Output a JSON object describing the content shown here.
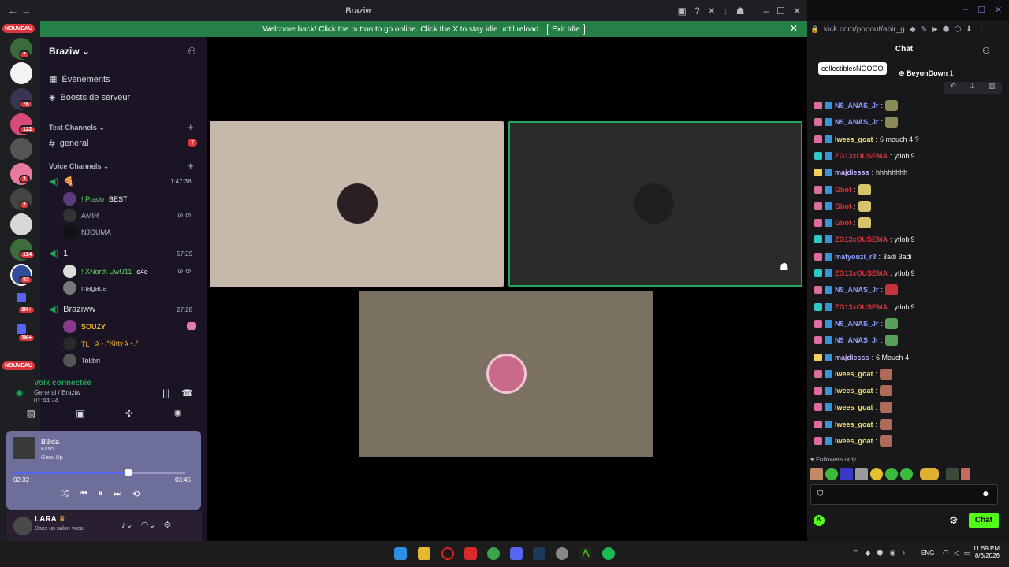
{
  "window": {
    "title": "Braziw"
  },
  "banner": {
    "text": "Welcome back! Click the button to go online. Click the X to stay idle until reload.",
    "button": "Exit Idle"
  },
  "guilds": {
    "new_top": "NOUVEAU",
    "new_bottom": "NOUVEAU",
    "badges": [
      "7",
      "76",
      "122",
      "3",
      "2",
      "114",
      "83",
      "1K+",
      "1K+"
    ]
  },
  "server": {
    "name": "Braziw",
    "events": "Événements",
    "boosts": "Boosts de serveur",
    "text_category": "Text Channels",
    "text_channels": [
      {
        "name": "general",
        "badge": "7"
      }
    ],
    "voice_category": "Voice Channels",
    "voice_channels": [
      {
        "name": "🍕",
        "time": "1:47:38",
        "users": [
          {
            "name": "! Prado",
            "tag": "BEST",
            "color": "#6ad06a"
          },
          {
            "name": "AMIR .",
            "tag": "",
            "color": "#b5bac1"
          },
          {
            "name": "NJOUMA",
            "tag": "",
            "color": "#b5bac1"
          }
        ]
      },
      {
        "name": "1",
        "time": "57:29",
        "users": [
          {
            "name": "! XNorth UwU11",
            "tag": "c4e",
            "color": "#6ad06a"
          },
          {
            "name": "magada",
            "tag": "",
            "color": "#b5bac1"
          }
        ]
      },
      {
        "name": "Braziww",
        "time": "27:28",
        "users": [
          {
            "name": "SOUZY",
            "tag": "",
            "color": "#f0b232"
          },
          {
            "name": "TL",
            "tag": "✰⋆.°Kitty✰⋆.°",
            "color": "#f0b232"
          },
          {
            "name": "Tokbri",
            "tag": "",
            "color": "#dbdee1"
          }
        ]
      }
    ]
  },
  "voice_status": {
    "title": "Voix connectée",
    "sub": "General / Braziw",
    "time": "01:44:24"
  },
  "music": {
    "track": "B3ida",
    "artist": "Kaso",
    "album": "Grow Up",
    "elapsed": "02:32",
    "total": "03:45",
    "progress": 0.67
  },
  "user": {
    "name": "LARA",
    "status": "Dans un salon vocal"
  },
  "chat": {
    "url": "kick.com/popout/abir_g",
    "header": "Chat",
    "tooltip": "collectiblesNOOOO",
    "pinned_user": "BeyonDown",
    "pinned_count": "1",
    "messages": [
      {
        "user": "N9_ANAS_Jr",
        "text": "",
        "color": "#8ea0ff",
        "badge": "b1",
        "emote": "#8b8b5a"
      },
      {
        "user": "N9_ANAS_Jr",
        "text": "",
        "color": "#8ea0ff",
        "badge": "b1",
        "emote": "#8b8b5a"
      },
      {
        "user": "lwees_goat",
        "text": "6 mouch 4 ?",
        "color": "#f4e36b",
        "badge": "b1",
        "emote": ""
      },
      {
        "user": "ZG13xOUSEMA",
        "text": "ytlobi9",
        "color": "#e0323c",
        "badge": "b3",
        "emote": ""
      },
      {
        "user": "majdiesss",
        "text": "hhhhhhhh",
        "color": "#c8b4ff",
        "badge": "b4",
        "emote": ""
      },
      {
        "user": "Gbof",
        "text": "",
        "color": "#e0323c",
        "badge": "b1",
        "emote": "#d6c36a"
      },
      {
        "user": "Gbof",
        "text": "",
        "color": "#e0323c",
        "badge": "b1",
        "emote": "#d6c36a"
      },
      {
        "user": "Gbof",
        "text": "",
        "color": "#e0323c",
        "badge": "b1",
        "emote": "#d6c36a"
      },
      {
        "user": "ZG13xOUSEMA",
        "text": "ytlobi9",
        "color": "#e0323c",
        "badge": "b3",
        "emote": ""
      },
      {
        "user": "mafyouzi_r3",
        "text": "3adi 3adi",
        "color": "#8ea0ff",
        "badge": "b1",
        "emote": ""
      },
      {
        "user": "ZG13xOUSEMA",
        "text": "ytlobi9",
        "color": "#e0323c",
        "badge": "b3",
        "emote": ""
      },
      {
        "user": "N9_ANAS_Jr",
        "text": "",
        "color": "#8ea0ff",
        "badge": "b1",
        "emote": "#c8323c"
      },
      {
        "user": "ZG13xOUSEMA",
        "text": "ytlobi9",
        "color": "#e0323c",
        "badge": "b3",
        "emote": ""
      },
      {
        "user": "N9_ANAS_Jr",
        "text": "",
        "color": "#8ea0ff",
        "badge": "b1",
        "emote": "#5aa05a"
      },
      {
        "user": "N9_ANAS_Jr",
        "text": "",
        "color": "#8ea0ff",
        "badge": "b1",
        "emote": "#5aa05a"
      },
      {
        "user": "majdiesss",
        "text": "6 Mouch 4",
        "color": "#c8b4ff",
        "badge": "b4",
        "emote": ""
      },
      {
        "user": "lwees_goat",
        "text": "",
        "color": "#f4e36b",
        "badge": "b1",
        "emote": "#b06a5a"
      },
      {
        "user": "lwees_goat",
        "text": "",
        "color": "#f4e36b",
        "badge": "b1",
        "emote": "#b06a5a"
      },
      {
        "user": "lwees_goat",
        "text": "",
        "color": "#f4e36b",
        "badge": "b1",
        "emote": "#b06a5a"
      },
      {
        "user": "lwees_goat",
        "text": "",
        "color": "#f4e36b",
        "badge": "b1",
        "emote": "#b06a5a"
      },
      {
        "user": "lwees_goat",
        "text": "",
        "color": "#f4e36b",
        "badge": "b1",
        "emote": "#b06a5a"
      }
    ],
    "followers_only": "Followers only",
    "send_button": "Chat"
  },
  "taskbar": {
    "lang": "ENG",
    "time": "11:59 PM",
    "date": "8/6/2026"
  },
  "colors": {
    "accent": "#53fc18",
    "banner": "#248046",
    "kick_bg": "#18181b"
  }
}
